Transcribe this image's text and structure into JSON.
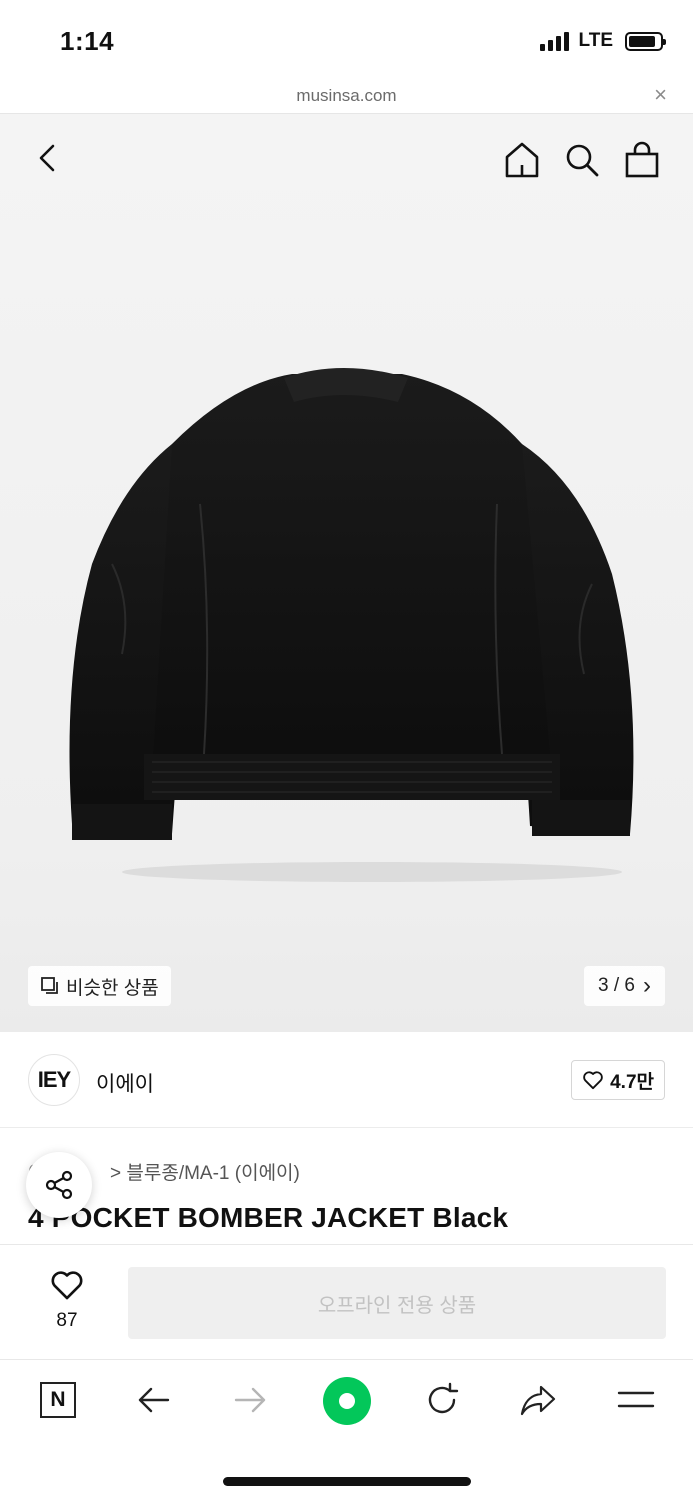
{
  "status_bar": {
    "time": "1:14",
    "network": "LTE"
  },
  "browser": {
    "url": "musinsa.com",
    "close_glyph": "×"
  },
  "header_icons": [
    "back-icon",
    "home-icon",
    "search-icon",
    "shopping-bag-icon"
  ],
  "gallery": {
    "similar_label": "비슷한 상품",
    "counter": "3 / 6",
    "counter_chevron": "›"
  },
  "brand": {
    "logo_text": "IEY",
    "name": "이에이",
    "likes": "4.7만"
  },
  "product": {
    "breadcrumb_partial": "아",
    "breadcrumb": "> 블루종/MA-1 (이에이)",
    "title": "4 POCKET BOMBER JACKET Black"
  },
  "purchase": {
    "like_count": "87",
    "button_label": "오프라인 전용 상품"
  },
  "toolbar": {
    "n_label": "N",
    "accent_color": "#03c75a"
  }
}
